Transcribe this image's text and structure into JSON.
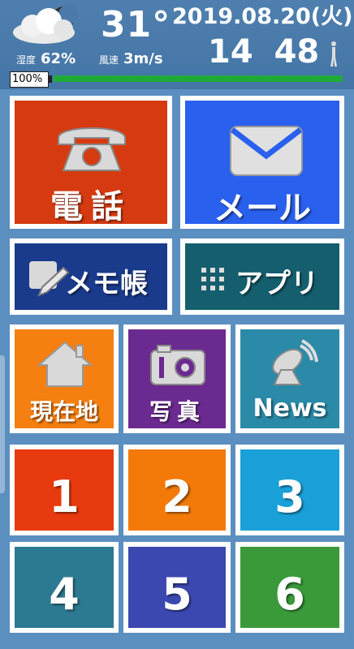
{
  "status": {
    "weather_icon": "cloud-moon-icon",
    "temperature": "31°",
    "date": "2019.08.20(火)",
    "time": "14 48",
    "humidity_label": "湿度",
    "humidity_value": "62%",
    "wind_label": "風速",
    "wind_value": "3m/s",
    "battery": "100%",
    "battery_bar_level": 1.0,
    "walker_icon": "walking-person-icon"
  },
  "tiles": {
    "phone": {
      "label": "電話",
      "icon": "telephone-icon",
      "color": "#d63a10"
    },
    "mail": {
      "label": "メール",
      "icon": "envelope-icon",
      "color": "#2a60ee"
    },
    "memo": {
      "label": "メモ帳",
      "icon": "pencil-note-icon",
      "color": "#1a3a8c"
    },
    "apps": {
      "label": "アプリ",
      "icon": "grid-icon",
      "color": "#155e6e"
    },
    "location": {
      "label": "現在地",
      "icon": "house-icon",
      "color": "#f57f10"
    },
    "photo": {
      "label": "写真",
      "icon": "camera-icon",
      "color": "#6b2a90"
    },
    "news": {
      "label": "News",
      "icon": "satellite-dish-icon",
      "color": "#2a8aa8"
    },
    "n1": {
      "label": "1",
      "color": "#e83a0f"
    },
    "n2": {
      "label": "2",
      "color": "#f37a09"
    },
    "n3": {
      "label": "3",
      "color": "#1aa0d8"
    },
    "n4": {
      "label": "4",
      "color": "#2c7a92"
    },
    "n5": {
      "label": "5",
      "color": "#3b48b0"
    },
    "n6": {
      "label": "6",
      "color": "#3a9a3a"
    }
  }
}
